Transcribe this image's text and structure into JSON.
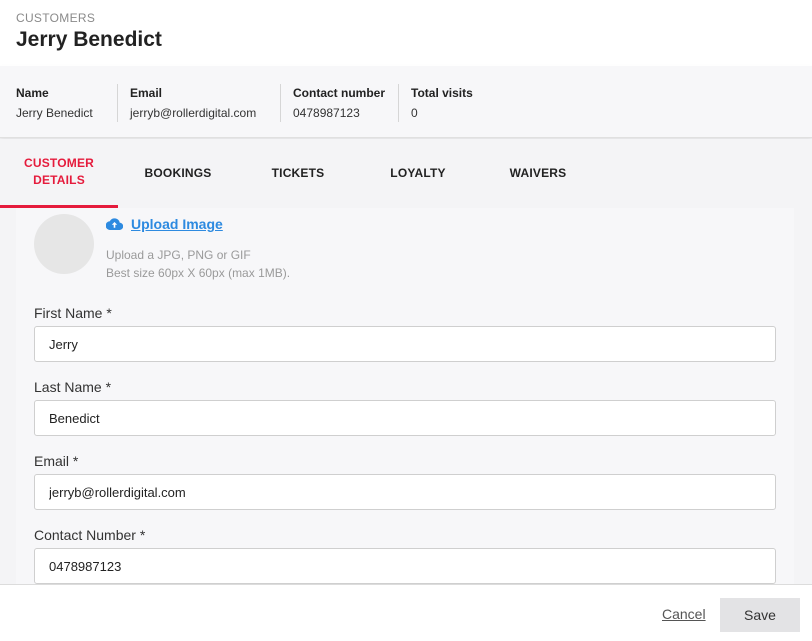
{
  "header": {
    "breadcrumb": "CUSTOMERS",
    "title": "Jerry Benedict"
  },
  "summary": {
    "columns": [
      {
        "label": "Name",
        "value": "Jerry Benedict"
      },
      {
        "label": "Email",
        "value": "jerryb@rollerdigital.com"
      },
      {
        "label": "Contact number",
        "value": "0478987123"
      },
      {
        "label": "Total visits",
        "value": "0"
      }
    ]
  },
  "tabs": {
    "customer_details_line1": "CUSTOMER",
    "customer_details_line2": "DETAILS",
    "bookings": "BOOKINGS",
    "tickets": "TICKETS",
    "loyalty": "LOYALTY",
    "waivers": "WAIVERS",
    "active": "customer-details"
  },
  "upload": {
    "link": "Upload Image",
    "hint1": "Upload a JPG, PNG or GIF",
    "hint2": "Best size 60px X 60px (max 1MB).",
    "icon": "cloud-upload-icon"
  },
  "form": {
    "first_name": {
      "label": "First Name *",
      "value": "Jerry"
    },
    "last_name": {
      "label": "Last Name *",
      "value": "Benedict"
    },
    "email": {
      "label": "Email *",
      "value": "jerryb@rollerdigital.com"
    },
    "contact": {
      "label": "Contact Number *",
      "value": "0478987123"
    }
  },
  "footer": {
    "cancel": "Cancel",
    "save": "Save"
  },
  "colors": {
    "accent": "#e51b3c",
    "link": "#2d8ae0"
  }
}
